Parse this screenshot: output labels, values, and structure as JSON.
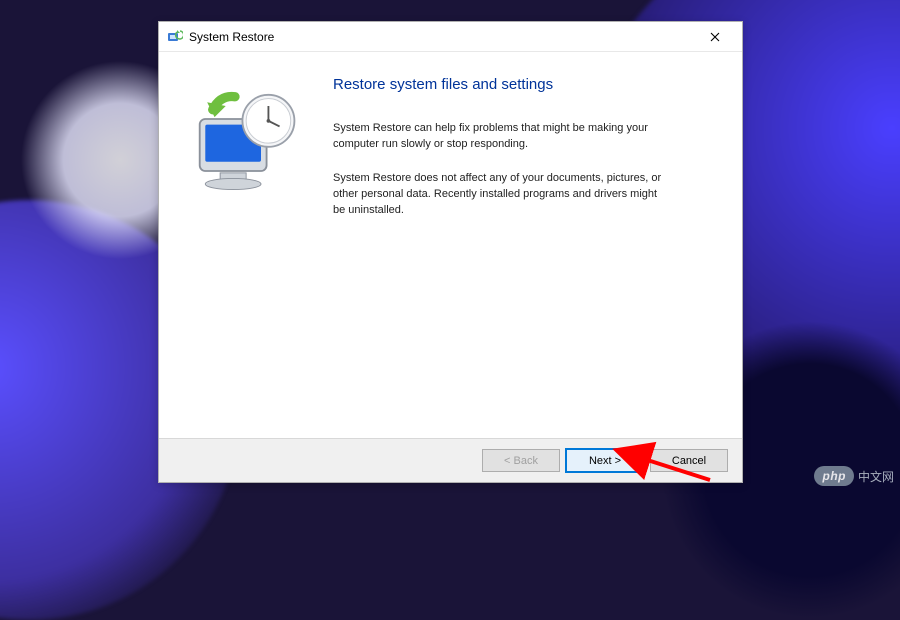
{
  "titlebar": {
    "title": "System Restore"
  },
  "content": {
    "heading": "Restore system files and settings",
    "para1": "System Restore can help fix problems that might be making your computer run slowly or stop responding.",
    "para2": "System Restore does not affect any of your documents, pictures, or other personal data. Recently installed programs and drivers might be uninstalled."
  },
  "buttons": {
    "back": "< Back",
    "next": "Next >",
    "cancel": "Cancel"
  },
  "watermark": {
    "brand": "php",
    "text": "中文网"
  }
}
